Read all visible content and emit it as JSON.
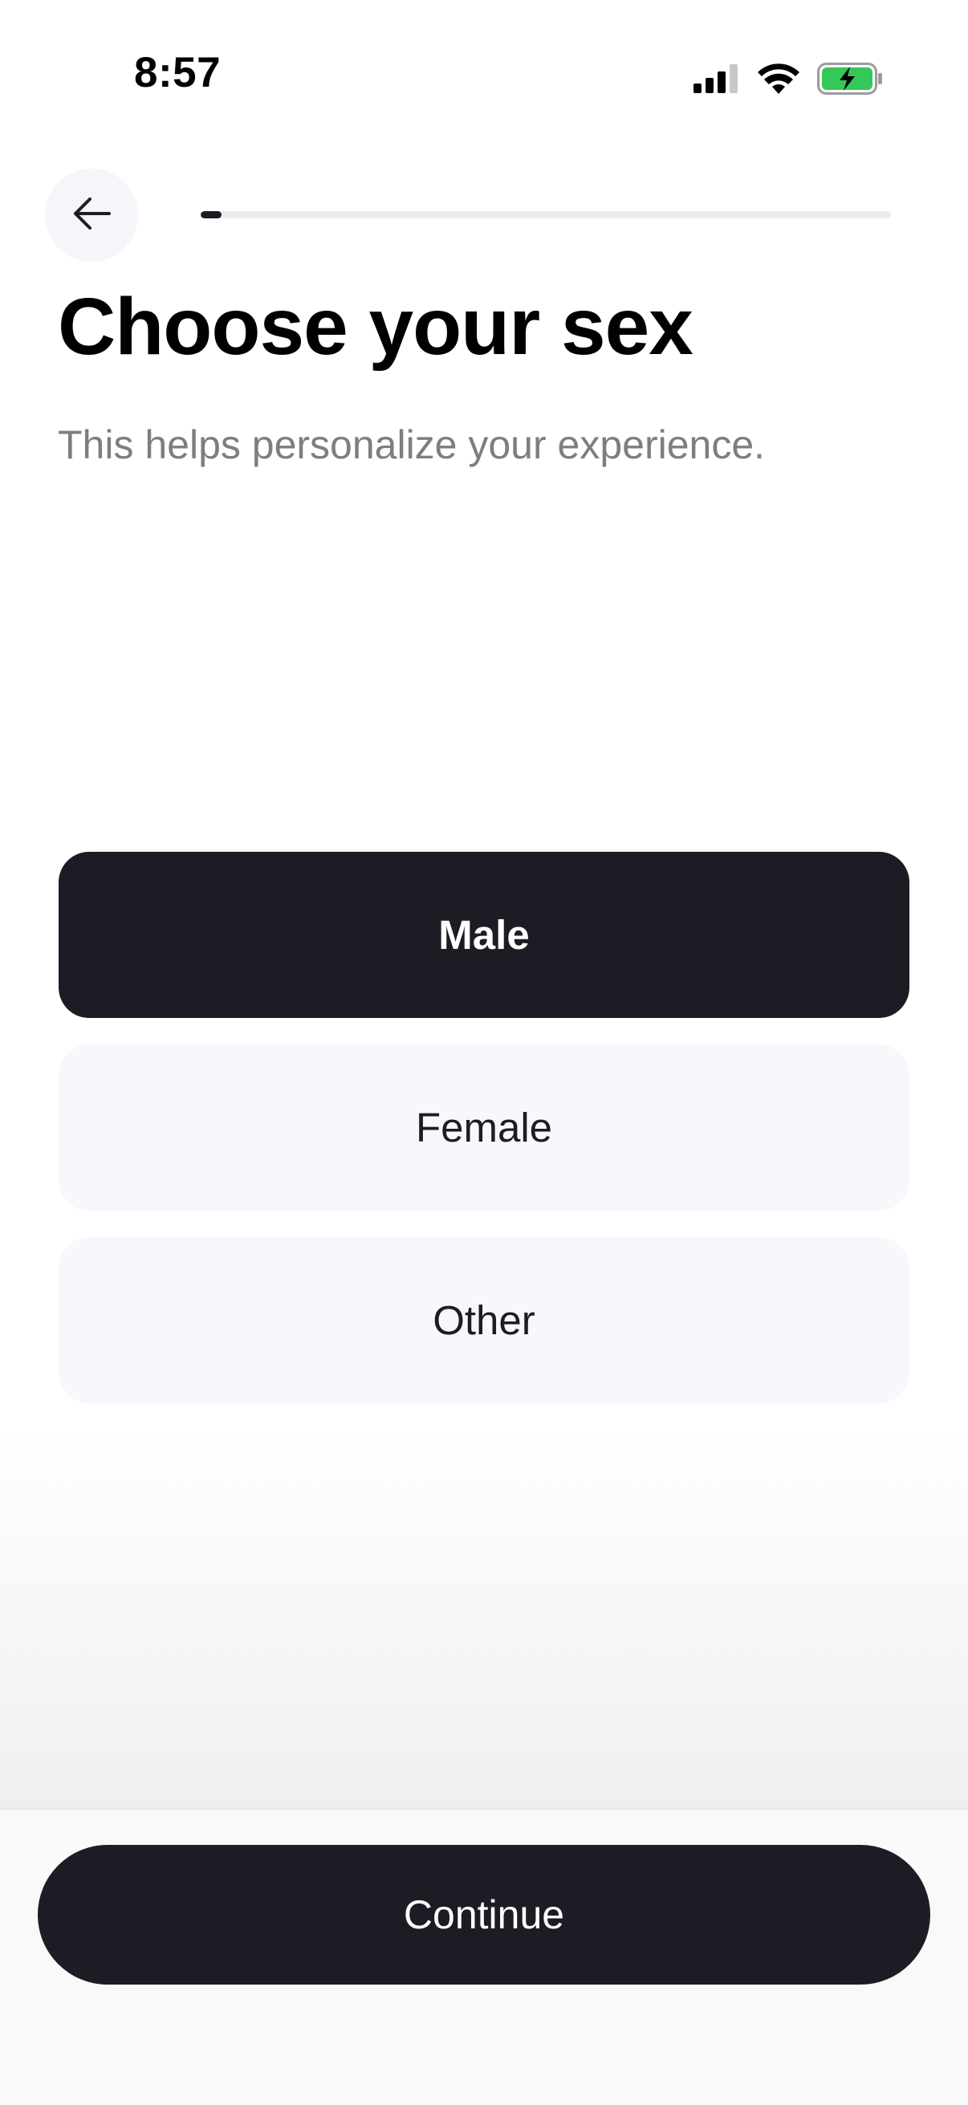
{
  "status_bar": {
    "time": "8:57",
    "icons": [
      "cellular-signal-icon",
      "wifi-icon",
      "battery-charging-icon"
    ],
    "battery_color": "#34c759"
  },
  "header": {
    "back_icon": "arrow-left-icon",
    "progress_fraction": 0.03
  },
  "title": "Choose your sex",
  "subtitle": "This helps personalize your experience.",
  "options": [
    {
      "label": "Male",
      "selected": true
    },
    {
      "label": "Female",
      "selected": false
    },
    {
      "label": "Other",
      "selected": false
    }
  ],
  "continue_label": "Continue",
  "colors": {
    "primary_dark": "#1d1c24",
    "option_bg": "#f8f8fc",
    "subtitle": "#7d7d82"
  }
}
